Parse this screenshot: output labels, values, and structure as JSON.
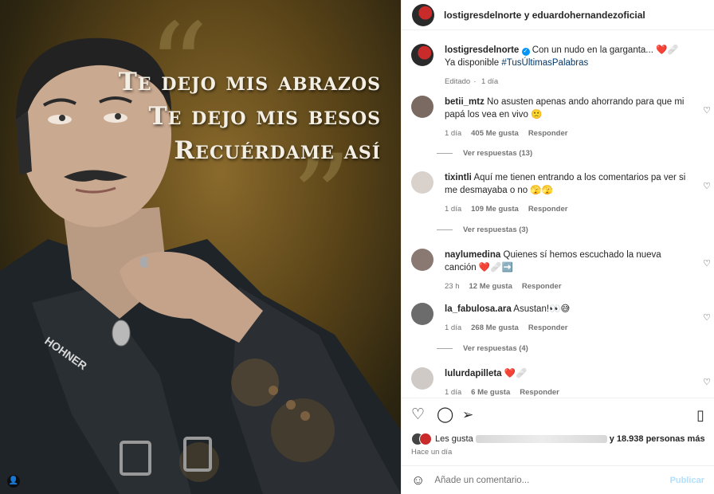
{
  "header": {
    "account_line": "lostigresdelnorte y eduardohernandezoficial"
  },
  "image": {
    "lyrics": [
      "Te dejo mis abrazos",
      "Te dejo mis besos",
      "Recuérdame así"
    ]
  },
  "caption": {
    "user": "lostigresdelnorte",
    "text": "Con un nudo en la garganta... ❤️🩹",
    "line2": "Ya disponible",
    "hashtag": "#TusÚltimasPalabras",
    "edited": "Editado",
    "time": "1 día"
  },
  "comments": [
    {
      "user": "betii_mtz",
      "text": "No asusten apenas ando ahorrando para que mi papá los vea en vivo 🙁",
      "time": "1 día",
      "likes": "405 Me gusta",
      "reply": "Responder",
      "replies": "Ver respuestas (13)"
    },
    {
      "user": "tixintli",
      "text": "Aquí me tienen entrando a los comentarios pa ver si me desmayaba o no 🫣🫣",
      "time": "1 día",
      "likes": "109 Me gusta",
      "reply": "Responder",
      "replies": "Ver respuestas (3)"
    },
    {
      "user": "naylumedina",
      "text": "Quienes sí hemos escuchado la nueva canción ❤️🩹➡️",
      "time": "23 h",
      "likes": "12 Me gusta",
      "reply": "Responder"
    },
    {
      "user": "la_fabulosa.ara",
      "text": "Asustan!👀😅",
      "time": "1 día",
      "likes": "268 Me gusta",
      "reply": "Responder",
      "replies": "Ver respuestas (4)"
    },
    {
      "user": "lulurdapilleta",
      "text": "❤️🩹",
      "time": "1 día",
      "likes": "6 Me gusta",
      "reply": "Responder"
    }
  ],
  "likes": {
    "prefix": "Les gusta",
    "suffix": "y 18.938 personas más"
  },
  "posted": "Hace un día",
  "composer": {
    "placeholder": "Añade un comentario...",
    "publish": "Publicar"
  },
  "icons": [
    "heart-icon",
    "comment-icon",
    "share-icon",
    "bookmark-icon",
    "emoji-icon"
  ]
}
